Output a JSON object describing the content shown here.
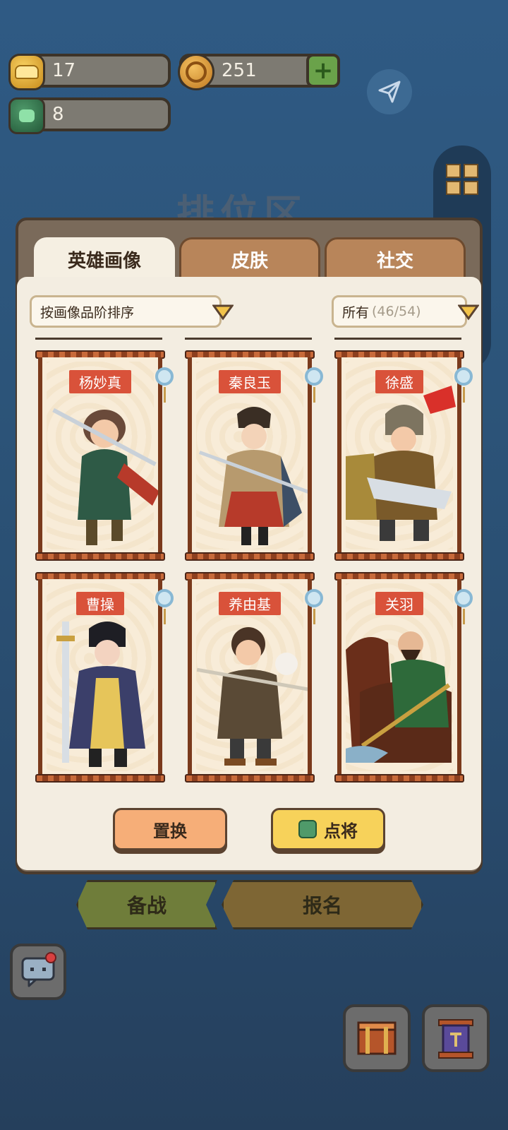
{
  "currencies": {
    "gold": "17",
    "coin": "251",
    "badge": "8"
  },
  "background_title": "排位区",
  "tabs": [
    {
      "label": "英雄画像",
      "active": true
    },
    {
      "label": "皮肤",
      "active": false
    },
    {
      "label": "社交",
      "active": false
    }
  ],
  "filters": {
    "sort": "按画像品阶排序",
    "owner": "所有",
    "owner_count": "(46/54)"
  },
  "heroes": [
    {
      "name": "杨妙真",
      "color": "#2e5a46"
    },
    {
      "name": "秦良玉",
      "color": "#b79a6e"
    },
    {
      "name": "徐盛",
      "color": "#7a5a2a"
    },
    {
      "name": "曹操",
      "color": "#3b3f6a"
    },
    {
      "name": "养由基",
      "color": "#5a4a36"
    },
    {
      "name": "关羽",
      "color": "#2e6a3a"
    }
  ],
  "actions": {
    "swap": "置换",
    "pick": "点将"
  },
  "nav": {
    "prepare": "备战",
    "signup": "报名"
  },
  "colors": {
    "accent_red": "#d9523a",
    "panel_bg": "#f3ede1",
    "background": "#2c5479"
  }
}
